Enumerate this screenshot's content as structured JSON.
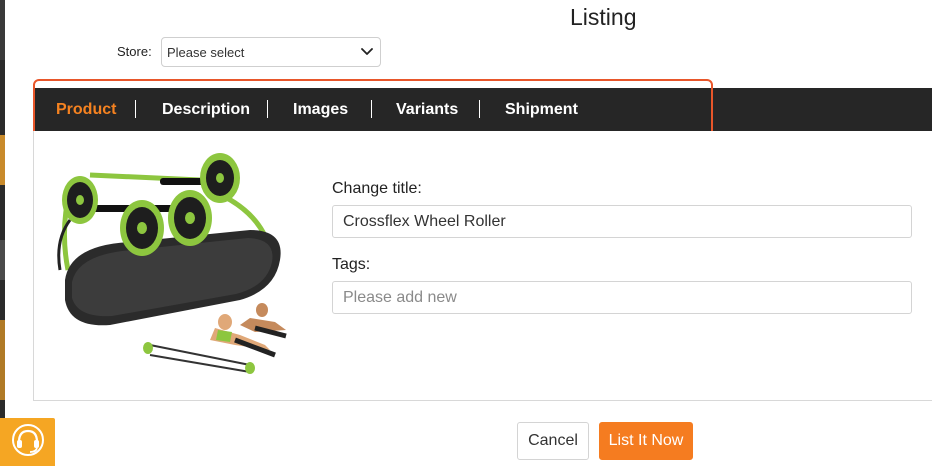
{
  "header": {
    "title": "Listing"
  },
  "store": {
    "label": "Store:",
    "selected": "Please select"
  },
  "tabs": [
    {
      "label": "Product",
      "active": true
    },
    {
      "label": "Description",
      "active": false
    },
    {
      "label": "Images",
      "active": false
    },
    {
      "label": "Variants",
      "active": false
    },
    {
      "label": "Shipment",
      "active": false
    }
  ],
  "form": {
    "title_label": "Change title:",
    "title_value": "Crossflex Wheel Roller",
    "tags_label": "Tags:",
    "tags_placeholder": "Please add new"
  },
  "actions": {
    "cancel_label": "Cancel",
    "submit_label": "List It Now"
  },
  "colors": {
    "accent": "#f57c20",
    "tabbar_bg": "#262626",
    "highlight": "#e8562a",
    "support_bg": "#f5a623"
  },
  "icons": {
    "select_arrow": "chevron-down-icon",
    "support": "headset-support-icon"
  }
}
